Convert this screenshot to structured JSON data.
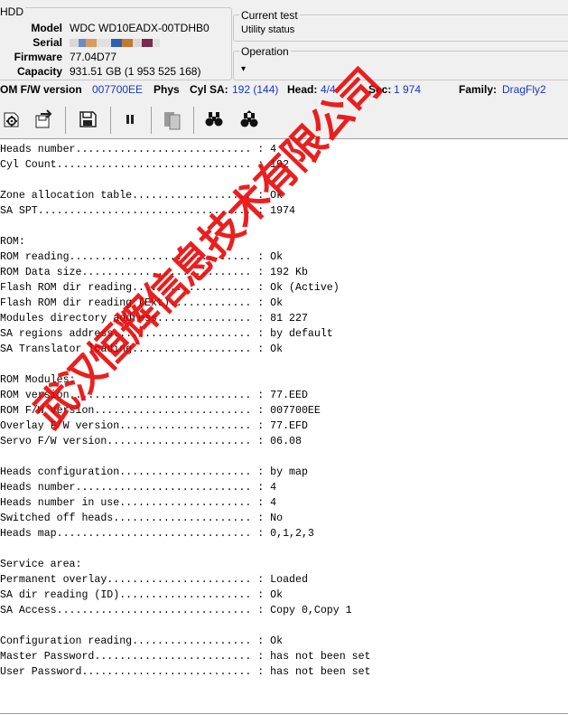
{
  "hdd": {
    "caption": "HDD",
    "model_label": "Model",
    "model": "WDC WD10EADX-00TDHB0",
    "serial_label": "Serial",
    "firmware_label": "Firmware",
    "firmware": "77.04D77",
    "capacity_label": "Capacity",
    "capacity": "931.51 GB (1 953 525 168)"
  },
  "current_test": {
    "title": "Current test",
    "value": "Utility status"
  },
  "operation": {
    "title": "Operation",
    "dropdown_glyph": "▾"
  },
  "status": {
    "rom_fw_label": "OM F/W version",
    "rom_fw": "007700EE",
    "phys_label": "Phys",
    "cyl_sa_label": "Cyl SA:",
    "cyl_sa": "192 (144)",
    "head_label": "Head:",
    "head": "4/4",
    "sec_label": "Sec:",
    "sec": "1 974",
    "family_label": "Family:",
    "family": "DragFly2"
  },
  "toolbar": {
    "icons": [
      "gear-run-icon",
      "save-load-icon",
      "save-icon",
      "pause-icon",
      "copy-icon",
      "binoculars-icon",
      "binoculars-next-icon"
    ]
  },
  "log_text": "Heads number............................ : 4\nCyl Count............................... : 192\n\nZone allocation table................... : Ok\nSA SPT.................................. : 1974\n\nROM:\nROM reading............................. : Ok\nROM Data size........................... : 192 Kb\nFlash ROM dir reading................... : Ok (Active)\nFlash ROM dir reading (Ext)............. : Ok\nModules directory address............... : 81 227\nSA regions address...................... : by default\nSA Translator loading................... : Ok\n\nROM Modules:\nROM version............................. : 77.EED\nROM F/W version......................... : 007700EE\nOverlay F/W version..................... : 77.EFD\nServo F/W version....................... : 06.08\n\nHeads configuration..................... : by map\nHeads number............................ : 4\nHeads number in use..................... : 4\nSwitched off heads...................... : No\nHeads map............................... : 0,1,2,3\n\nService area:\nPermanent overlay....................... : Loaded\nSA dir reading (ID)..................... : Ok\nSA Access............................... : Copy 0,Copy 1\n\nConfiguration reading................... : Ok\nMaster Password......................... : has not been set\nUser Password........................... : has not been set",
  "watermark": "武汉恒辉信息技术有限公司"
}
